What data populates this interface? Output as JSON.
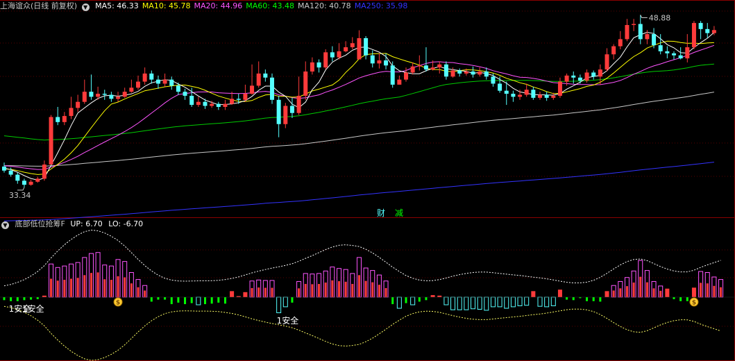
{
  "colors": {
    "background": "#000000",
    "grid": "#5a0000",
    "divider": "#8b0000",
    "candle_up": "#ff3b3b",
    "candle_down": "#54ffff",
    "ma5": "#ffffff",
    "ma10": "#ffff00",
    "ma20": "#ff55ff",
    "ma60": "#00cc00",
    "ma120": "#c8c8c8",
    "ma250": "#3333ff",
    "band": "#ffff66",
    "osc_pos": "#ff3b3b",
    "osc_pos_outline": "#ff55ff",
    "osc_neg": "#00ff00",
    "osc_neg_outline": "#54ffff",
    "label_text": "#ffffff",
    "coin": "#ffcc33"
  },
  "header": {
    "icon": "chevron-down-icon",
    "title": "上海谊众(日线 前复权)",
    "ma_labels": [
      {
        "text": "MA5: 46.33",
        "color": "#ffffff"
      },
      {
        "text": "MA10: 45.78",
        "color": "#ffff00"
      },
      {
        "text": "MA20: 44.96",
        "color": "#ff55ff"
      },
      {
        "text": "MA60: 43.48",
        "color": "#00ff00"
      },
      {
        "text": "MA120: 40.78",
        "color": "#c8c8c8"
      },
      {
        "text": "MA250: 35.98",
        "color": "#3333ff"
      }
    ]
  },
  "indicator_header": {
    "icon": "chevron-down-icon",
    "title": "底部低位抢筹F",
    "up_label": "UP: 6.70",
    "lo_label": "LO: -6.70"
  },
  "chart_data": {
    "type": "candlestick",
    "price_range": [
      31.0,
      50.5
    ],
    "annotations": {
      "high_label": "48.88",
      "low_label": "33.34",
      "fin_markers": [
        {
          "text": "财",
          "color": "#54ffff"
        },
        {
          "text": "减",
          "color": "#00ff00"
        }
      ]
    },
    "candles": [
      [
        35.4,
        35.0,
        35.8,
        34.8
      ],
      [
        35.0,
        34.6,
        35.3,
        34.4
      ],
      [
        34.6,
        34.0,
        34.8,
        33.7
      ],
      [
        34.0,
        33.6,
        34.2,
        33.34
      ],
      [
        33.6,
        33.9,
        34.1,
        33.5
      ],
      [
        33.9,
        34.2,
        34.4,
        33.8
      ],
      [
        34.2,
        35.6,
        36.0,
        34.0
      ],
      [
        35.6,
        40.3,
        40.5,
        35.6
      ],
      [
        40.3,
        39.8,
        41.3,
        39.5
      ],
      [
        39.8,
        40.4,
        40.8,
        39.5
      ],
      [
        40.4,
        41.2,
        42.3,
        40.1
      ],
      [
        41.2,
        41.8,
        42.5,
        40.8
      ],
      [
        41.8,
        42.8,
        44.0,
        41.6
      ],
      [
        42.8,
        42.3,
        44.5,
        42.0
      ],
      [
        42.3,
        42.6,
        43.3,
        42.0
      ],
      [
        42.6,
        42.5,
        43.0,
        42.0
      ],
      [
        42.5,
        42.1,
        42.8,
        41.8
      ],
      [
        42.1,
        42.3,
        42.8,
        41.8
      ],
      [
        42.3,
        42.8,
        43.2,
        42.2
      ],
      [
        42.8,
        43.2,
        44.0,
        42.7
      ],
      [
        43.2,
        43.8,
        44.4,
        43.0
      ],
      [
        43.8,
        44.6,
        45.2,
        43.5
      ],
      [
        44.6,
        44.0,
        44.9,
        43.6
      ],
      [
        44.0,
        43.6,
        44.4,
        43.1
      ],
      [
        43.6,
        44.0,
        44.6,
        43.3
      ],
      [
        44.0,
        43.4,
        44.3,
        43.0
      ],
      [
        43.4,
        42.8,
        43.7,
        42.5
      ],
      [
        42.8,
        42.4,
        43.1,
        42.0
      ],
      [
        42.4,
        41.5,
        43.2,
        41.3
      ],
      [
        41.5,
        41.8,
        42.3,
        41.3
      ],
      [
        41.8,
        41.4,
        42.1,
        41.1
      ],
      [
        41.4,
        41.6,
        41.9,
        41.2
      ],
      [
        41.6,
        41.3,
        41.8,
        41.0
      ],
      [
        41.3,
        41.6,
        42.0,
        41.0
      ],
      [
        41.6,
        42.1,
        42.8,
        41.5
      ],
      [
        42.1,
        42.0,
        42.6,
        41.6
      ],
      [
        42.0,
        42.6,
        43.5,
        41.8
      ],
      [
        42.6,
        43.4,
        45.5,
        42.5
      ],
      [
        43.4,
        44.6,
        45.8,
        43.2
      ],
      [
        44.6,
        44.2,
        45.0,
        43.8
      ],
      [
        44.2,
        42.0,
        44.6,
        41.6
      ],
      [
        42.0,
        39.6,
        42.4,
        38.3
      ],
      [
        39.6,
        41.4,
        41.7,
        39.2
      ],
      [
        41.4,
        40.7,
        42.2,
        40.2
      ],
      [
        40.7,
        42.4,
        44.3,
        40.5
      ],
      [
        42.4,
        44.8,
        45.8,
        42.0
      ],
      [
        44.8,
        45.7,
        46.2,
        44.5
      ],
      [
        45.7,
        45.2,
        46.0,
        44.7
      ],
      [
        45.2,
        46.7,
        47.0,
        45.0
      ],
      [
        46.7,
        46.2,
        47.3,
        45.8
      ],
      [
        46.2,
        46.8,
        47.6,
        46.0
      ],
      [
        46.8,
        47.2,
        47.8,
        46.7
      ],
      [
        47.2,
        47.6,
        48.2,
        47.0
      ],
      [
        46.0,
        48.1,
        48.88,
        46.0
      ],
      [
        48.1,
        46.4,
        48.3,
        46.0
      ],
      [
        46.4,
        45.6,
        46.9,
        45.2
      ],
      [
        45.6,
        45.9,
        46.6,
        45.1
      ],
      [
        45.9,
        45.4,
        46.6,
        45.0
      ],
      [
        45.4,
        43.5,
        45.8,
        43.2
      ],
      [
        43.5,
        44.0,
        44.4,
        43.6
      ],
      [
        44.0,
        44.7,
        45.2,
        43.8
      ],
      [
        44.7,
        45.3,
        45.7,
        44.5
      ],
      [
        45.3,
        45.4,
        46.4,
        44.9
      ],
      [
        45.4,
        45.0,
        47.2,
        44.8
      ],
      [
        45.0,
        45.2,
        45.9,
        44.9
      ],
      [
        45.2,
        45.5,
        45.8,
        44.6
      ],
      [
        45.5,
        44.3,
        45.8,
        44.0
      ],
      [
        44.3,
        44.9,
        45.2,
        44.2
      ],
      [
        44.9,
        44.6,
        45.1,
        44.3
      ],
      [
        44.6,
        44.8,
        45.1,
        44.4
      ],
      [
        44.8,
        44.5,
        45.3,
        44.2
      ],
      [
        44.5,
        44.8,
        45.2,
        44.3
      ],
      [
        44.8,
        44.3,
        45.2,
        44.0
      ],
      [
        44.3,
        43.6,
        44.6,
        43.3
      ],
      [
        43.6,
        42.9,
        44.3,
        42.7
      ],
      [
        42.9,
        42.6,
        43.8,
        41.5
      ],
      [
        42.6,
        42.3,
        42.9,
        41.8
      ],
      [
        42.3,
        42.5,
        43.0,
        42.0
      ],
      [
        42.5,
        43.0,
        43.6,
        42.3
      ],
      [
        43.0,
        42.2,
        43.3,
        42.0
      ],
      [
        42.2,
        42.5,
        42.8,
        42.0
      ],
      [
        42.5,
        42.2,
        42.8,
        41.9
      ],
      [
        42.2,
        42.4,
        42.7,
        42.0
      ],
      [
        42.4,
        43.8,
        44.2,
        42.2
      ],
      [
        43.8,
        44.4,
        44.6,
        43.4
      ],
      [
        44.4,
        44.2,
        44.8,
        43.6
      ],
      [
        44.2,
        43.9,
        44.5,
        43.6
      ],
      [
        43.9,
        44.7,
        45.0,
        43.7
      ],
      [
        44.7,
        44.3,
        44.9,
        44.0
      ],
      [
        44.3,
        45.0,
        45.5,
        43.5
      ],
      [
        45.0,
        46.5,
        47.1,
        44.8
      ],
      [
        46.5,
        47.3,
        47.5,
        46.0
      ],
      [
        47.3,
        48.0,
        48.8,
        47.0
      ],
      [
        48.0,
        49.4,
        50.0,
        47.8
      ],
      [
        49.4,
        49.5,
        50.0,
        48.8
      ],
      [
        49.5,
        48.0,
        50.4,
        47.5
      ],
      [
        48.0,
        48.5,
        48.9,
        47.5
      ],
      [
        48.5,
        47.4,
        49.1,
        47.1
      ],
      [
        47.4,
        46.8,
        48.5,
        46.5
      ],
      [
        46.8,
        46.6,
        47.3,
        46.1
      ],
      [
        46.6,
        46.4,
        46.8,
        46.0
      ],
      [
        46.4,
        46.1,
        47.2,
        46.0
      ],
      [
        46.1,
        47.2,
        48.5,
        45.7
      ],
      [
        47.2,
        49.6,
        49.8,
        47.0
      ],
      [
        49.6,
        49.0,
        49.8,
        48.0
      ],
      [
        49.0,
        48.6,
        49.6,
        48.1
      ],
      [
        48.6,
        48.9,
        49.3,
        48.4
      ]
    ],
    "oscillator": [
      -0.6,
      -0.8,
      -0.8,
      -0.6,
      -0.5,
      -0.4,
      0.3,
      6.7,
      6.0,
      6.3,
      6.7,
      7.0,
      8.0,
      8.8,
      9.0,
      6.5,
      6.3,
      7.6,
      7.2,
      5.0,
      3.6,
      2.4,
      -0.9,
      -0.5,
      -0.5,
      -1.4,
      -1.1,
      -1.4,
      -1.2,
      -1.6,
      -1.4,
      -1.3,
      -1.1,
      -1.3,
      1.2,
      0.2,
      1.0,
      3.3,
      3.5,
      3.4,
      3.4,
      -3.2,
      -2.0,
      -1.1,
      3.2,
      4.8,
      4.7,
      4.8,
      5.3,
      6.1,
      5.8,
      5.6,
      4.8,
      8.0,
      5.9,
      5.4,
      4.5,
      3.3,
      -1.4,
      -2.3,
      -1.2,
      -1.6,
      -0.9,
      -0.6,
      0.4,
      0.3,
      -1.6,
      -2.6,
      -2.6,
      -2.6,
      -2.4,
      -2.5,
      -2.7,
      -2.0,
      -2.0,
      -2.3,
      -2.0,
      -1.8,
      -1.7,
      1.2,
      -1.9,
      -2.0,
      -1.8,
      1.5,
      -0.5,
      -0.6,
      -0.2,
      -0.8,
      -0.8,
      -0.9,
      1.2,
      2.4,
      3.2,
      4.0,
      5.3,
      7.4,
      5.4,
      3.2,
      2.3,
      1.7,
      -0.4,
      -0.8,
      -0.8,
      1.9,
      5.2,
      5.0,
      4.1,
      3.6
    ],
    "signals": [
      {
        "index": 1,
        "text": "1安全"
      },
      {
        "index": 3,
        "text": "1安全"
      },
      {
        "index": 41,
        "text": "1安全"
      }
    ],
    "coin_markers": [
      {
        "index": 17,
        "icon": "money-bag-icon",
        "glyph": "$"
      },
      {
        "index": 103,
        "icon": "money-bag-icon",
        "glyph": "$"
      }
    ]
  }
}
